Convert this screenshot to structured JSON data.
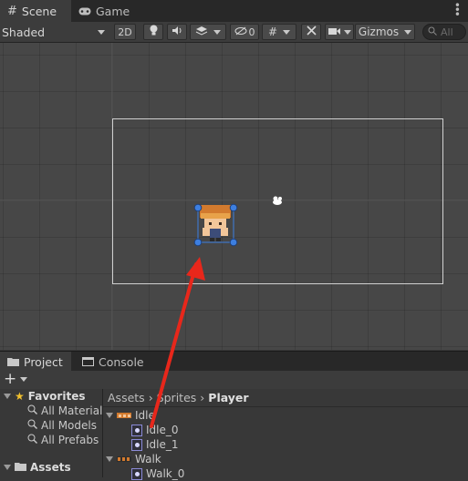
{
  "tabs": {
    "scene": "Scene",
    "game": "Game"
  },
  "toolbar": {
    "shading_mode": "Shaded",
    "mode_2d": "2D",
    "hidden_count": "0",
    "gizmos": "Gizmos",
    "search_placeholder": "All"
  },
  "bottom_tabs": {
    "project": "Project",
    "console": "Console"
  },
  "favorites": {
    "label": "Favorites",
    "items": [
      "All Materials",
      "All Models",
      "All Prefabs"
    ]
  },
  "assets_root": "Assets",
  "breadcrumb": {
    "items": [
      "Assets",
      "Sprites"
    ],
    "current": "Player"
  },
  "files": {
    "idle": "Idle",
    "idle_0": "Idle_0",
    "idle_1": "Idle_1",
    "walk": "Walk",
    "walk_0": "Walk_0"
  },
  "colors": {
    "accent": "#e8271b",
    "handle": "#3d7fe0"
  }
}
